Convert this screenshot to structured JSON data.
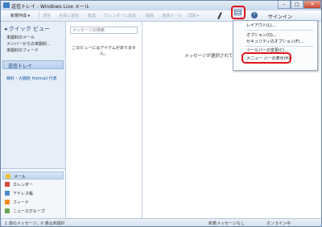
{
  "window": {
    "title": "送信トレイ - Windows Live メール",
    "buttons": {
      "minimize": "–",
      "maximize": "□",
      "close": "✕"
    }
  },
  "toolbar": {
    "items": [
      {
        "label": "新規作成 ▾",
        "enabled": true
      },
      {
        "label": "返信",
        "enabled": false
      },
      {
        "label": "全員に返信",
        "enabled": false
      },
      {
        "label": "転送",
        "enabled": false
      },
      {
        "label": "カレンダーに追加",
        "enabled": false
      },
      {
        "label": "削除",
        "enabled": false
      },
      {
        "label": "迷惑メール",
        "enabled": false
      },
      {
        "label": "同期 ▾",
        "enabled": false
      }
    ],
    "signin": "サインイン"
  },
  "nav": {
    "group": "◂ クイック ビュー",
    "subs": [
      "未開封のメール",
      "メンバーからの未開封...",
      "未開封のフィード"
    ],
    "selected": "送信トレイ",
    "account": "簡科・大器館 Hotmail 代表",
    "bottom": [
      {
        "label": "メール",
        "icon": "mail-icon",
        "active": true
      },
      {
        "label": "カレンダー",
        "icon": "calendar-icon",
        "active": false
      },
      {
        "label": "アドレス帳",
        "icon": "contacts-icon",
        "active": false
      },
      {
        "label": "フィード",
        "icon": "feed-icon",
        "active": false
      },
      {
        "label": "ニュースグループ",
        "icon": "newsgroup-icon",
        "active": false
      }
    ]
  },
  "list": {
    "search_placeholder": "メッセージの検索",
    "empty_line1": "このビューにはアイテムがありませ",
    "empty_line2": "ん。"
  },
  "reading": {
    "message": "メッセージが選択されていません"
  },
  "menu": {
    "items": [
      "レイアウト(L)...",
      "オプション(O)...",
      "セキュリティのオプション(F)...",
      "ツールバーの変更(C)...",
      "メニュー バーの表示(H)"
    ]
  },
  "status": {
    "left": "1 通のメッセージ、0 通は未開封",
    "right": "新着メッセージなし",
    "online": "オンライン中"
  },
  "colors": {
    "highlight": "#e0141c",
    "accent": "#1e3d6b"
  }
}
